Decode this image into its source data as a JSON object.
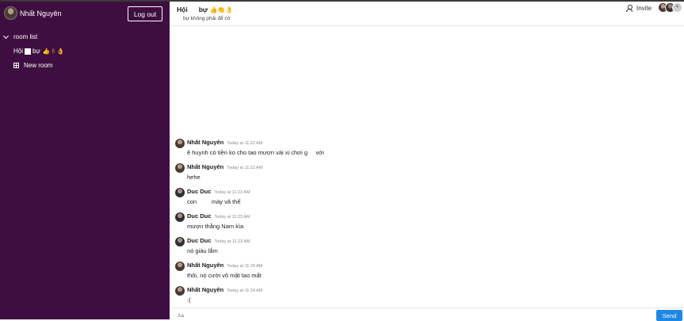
{
  "sidebar": {
    "user_name": "Nhất Nguyên",
    "logout_label": "Log out",
    "room_list_label": "room list",
    "room_item_prefix": "Hội",
    "room_item_suffix": "bự",
    "room_item_emojis": "👍✌👌",
    "new_room_label": "New room"
  },
  "header": {
    "room_name_part1": "Hội",
    "room_name_part2": "bự",
    "room_emojis": "👍👏👌",
    "topic": "bự không phải để cờ",
    "invite_label": "Invite"
  },
  "messages": [
    {
      "author": "Nhất Nguyên",
      "time": "Today at 11:22 AM",
      "text": "ê huynh có tiền ko cho tao mượn vài xị chơi g     với",
      "avatar": "nhat"
    },
    {
      "author": "Nhất Nguyên",
      "time": "Today at 11:22 AM",
      "text": "hehe",
      "avatar": "nhat"
    },
    {
      "author": "Duc Duc",
      "time": "Today at 11:23 AM",
      "text": "con         mày vã thế",
      "avatar": "duc"
    },
    {
      "author": "Duc Duc",
      "time": "Today at 11:23 AM",
      "text": "mượn thằng Nam kìa",
      "avatar": "duc"
    },
    {
      "author": "Duc Duc",
      "time": "Today at 11:23 AM",
      "text": "nó giàu lắm",
      "avatar": "duc"
    },
    {
      "author": "Nhất Nguyên",
      "time": "Today at 11:24 AM",
      "text": "thôi, nó cười vô mặt tao mất",
      "avatar": "nhat"
    },
    {
      "author": "Nhất Nguyên",
      "time": "Today at 11:24 AM",
      "text": ":(",
      "avatar": "nhat"
    }
  ],
  "composer": {
    "placeholder": "Aa",
    "send_label": "Send"
  },
  "colors": {
    "sidebar_bg": "#3f0e40",
    "send_button": "#1e88e5"
  }
}
